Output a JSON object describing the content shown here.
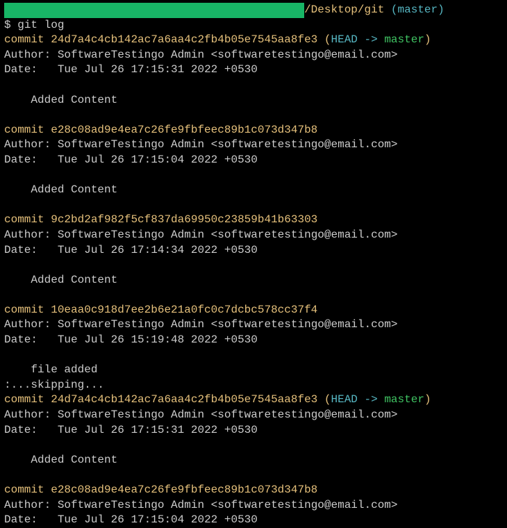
{
  "prompt": {
    "path_suffix": "/Desktop/git",
    "branch": "(master)",
    "dollar": "$",
    "command": "git log"
  },
  "commits": [
    {
      "label": "commit",
      "hash": "24d7a4c4cb142ac7a6aa4c2fb4b05e7545aa8fe3",
      "refs": {
        "open": "(",
        "head": "HEAD ->",
        "branch": "master",
        "close": ")"
      },
      "author_label": "Author:",
      "author": "SoftwareTestingo Admin <softwaretestingo@email.com>",
      "date_label": "Date:",
      "date": "Tue Jul 26 17:15:31 2022 +0530",
      "message": "Added Content"
    },
    {
      "label": "commit",
      "hash": "e28c08ad9e4ea7c26fe9fbfeec89b1c073d347b8",
      "author_label": "Author:",
      "author": "SoftwareTestingo Admin <softwaretestingo@email.com>",
      "date_label": "Date:",
      "date": "Tue Jul 26 17:15:04 2022 +0530",
      "message": "Added Content"
    },
    {
      "label": "commit",
      "hash": "9c2bd2af982f5cf837da69950c23859b41b63303",
      "author_label": "Author:",
      "author": "SoftwareTestingo Admin <softwaretestingo@email.com>",
      "date_label": "Date:",
      "date": "Tue Jul 26 17:14:34 2022 +0530",
      "message": "Added Content"
    },
    {
      "label": "commit",
      "hash": "10eaa0c918d7ee2b6e21a0fc0c7dcbc578cc37f4",
      "author_label": "Author:",
      "author": "SoftwareTestingo Admin <softwaretestingo@email.com>",
      "date_label": "Date:",
      "date": "Tue Jul 26 15:19:48 2022 +0530",
      "message": "file added"
    }
  ],
  "skipping": ":...skipping...",
  "repeat_commits": [
    {
      "label": "commit",
      "hash": "24d7a4c4cb142ac7a6aa4c2fb4b05e7545aa8fe3",
      "refs": {
        "open": "(",
        "head": "HEAD ->",
        "branch": "master",
        "close": ")"
      },
      "author_label": "Author:",
      "author": "SoftwareTestingo Admin <softwaretestingo@email.com>",
      "date_label": "Date:",
      "date": "Tue Jul 26 17:15:31 2022 +0530",
      "message": "Added Content"
    },
    {
      "label": "commit",
      "hash": "e28c08ad9e4ea7c26fe9fbfeec89b1c073d347b8",
      "author_label": "Author:",
      "author": "SoftwareTestingo Admin <softwaretestingo@email.com>",
      "date_label": "Date:",
      "date": "Tue Jul 26 17:15:04 2022 +0530"
    }
  ]
}
